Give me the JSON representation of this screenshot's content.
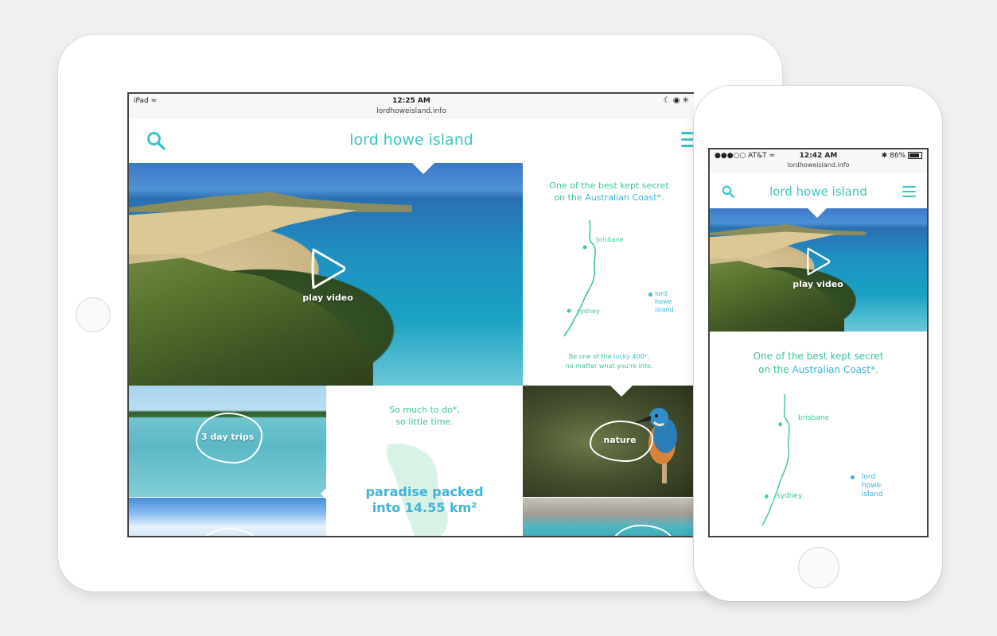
{
  "ipad": {
    "status": {
      "device": "iPad",
      "time": "12:25 AM",
      "url": "lordhoweisland.info",
      "right": "☾ ◉ ✳"
    },
    "header": {
      "title": "lord howe island"
    },
    "hero": {
      "play_label": "play video"
    },
    "map": {
      "headline_1": "One of the best kept secret",
      "headline_2_prefix": "on the ",
      "headline_2_link": "Australian Coast",
      "headline_2_suffix": "*.",
      "city_1": "brisbane",
      "city_2": "sydney",
      "island_1": "lord",
      "island_2": "howe",
      "island_3": "island",
      "footer_1_prefix": "Be one of the ",
      "footer_1_link": "lucky 400",
      "footer_1_suffix": "*,",
      "footer_2": "no matter what you're into."
    },
    "tiles": {
      "trips_label": "3 day trips",
      "nature_label": "nature",
      "todo_1": "So much to do*,",
      "todo_2": "so little time.",
      "paradise_1": "paradise packed",
      "paradise_2": "into 14.55 km²"
    }
  },
  "iphone": {
    "status": {
      "carrier": "●●●○○ AT&T",
      "time": "12:42 AM",
      "url": "lordhoweisland.info",
      "battery": "86%"
    },
    "header": {
      "title": "lord howe island"
    },
    "hero": {
      "play_label": "play video"
    },
    "map": {
      "headline_1": "One of the best kept secret",
      "headline_2_prefix": "on the ",
      "headline_2_link": "Australian Coast",
      "headline_2_suffix": "*.",
      "city_1": "brisbane",
      "city_2": "sydney",
      "island_1": "lord",
      "island_2": "howe",
      "island_3": "island"
    }
  },
  "colors": {
    "accent": "#3cc4c4",
    "teal": "#3cc4a0",
    "blue": "#3cb4d8"
  }
}
